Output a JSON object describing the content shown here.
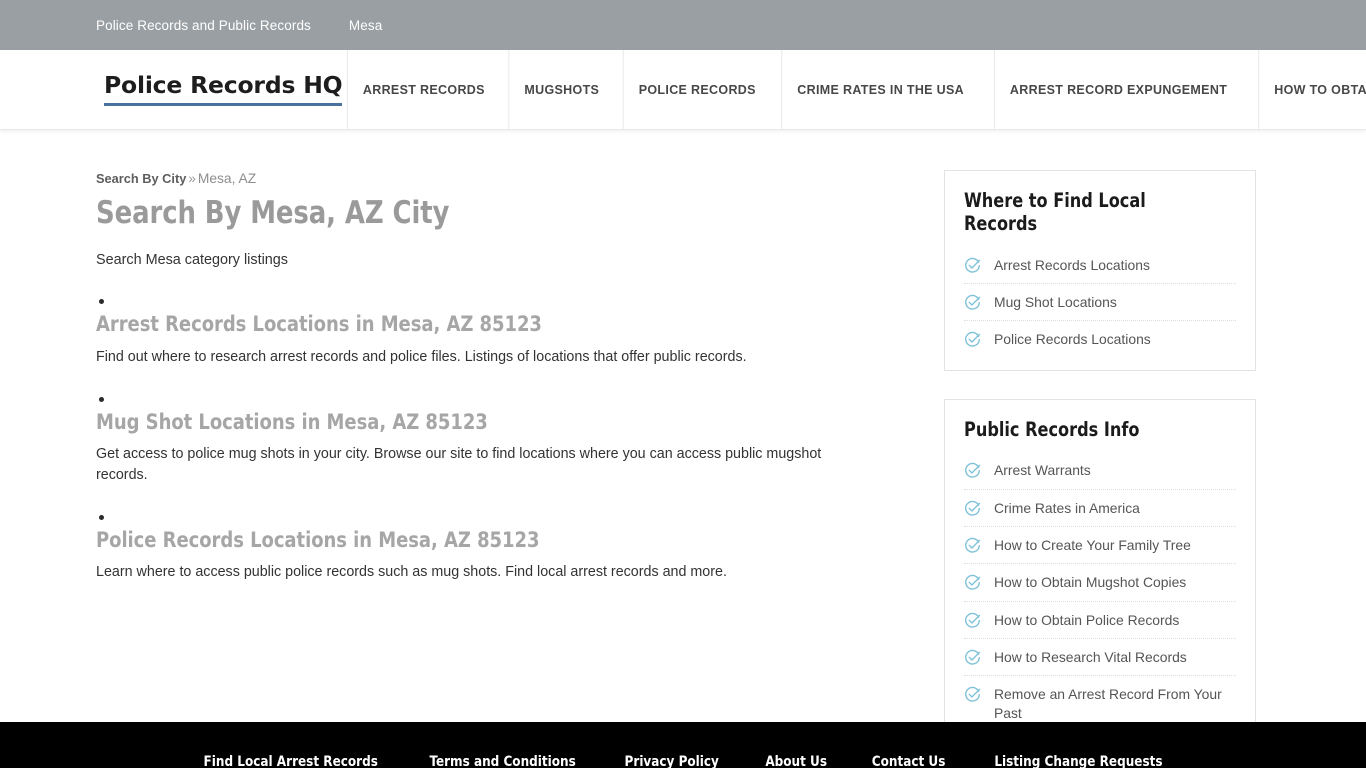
{
  "topbar": {
    "links": [
      {
        "label": "Police Records and Public Records"
      },
      {
        "label": "Mesa"
      }
    ]
  },
  "header": {
    "logo": "Police Records HQ",
    "logo_underline_color": "#46729c",
    "nav": [
      {
        "label": "ARREST RECORDS"
      },
      {
        "label": "MUGSHOTS"
      },
      {
        "label": "POLICE RECORDS"
      },
      {
        "label": "CRIME RATES IN THE USA"
      },
      {
        "label": "ARREST RECORD EXPUNGEMENT"
      },
      {
        "label": "HOW TO OBTAIN PUBLIC RECORDS"
      }
    ]
  },
  "breadcrumb": {
    "root": "Search By City",
    "separator": "»",
    "current": "Mesa, AZ"
  },
  "main": {
    "title": "Search By Mesa, AZ City",
    "intro": "Search Mesa category listings",
    "sections": [
      {
        "title": "Arrest Records Locations in Mesa, AZ 85123",
        "desc": "Find out where to research arrest records and police files. Listings of locations that offer public records."
      },
      {
        "title": "Mug Shot Locations in Mesa, AZ 85123",
        "desc": "Get access to police mug shots in your city. Browse our site to find locations where you can access public mugshot records."
      },
      {
        "title": "Police Records Locations in Mesa, AZ 85123",
        "desc": "Learn where to access public police records such as mug shots. Find local arrest records and more."
      }
    ]
  },
  "sidebar": {
    "icon_name": "check-circle-icon",
    "icon_color": "#7cc0d8",
    "widgets": [
      {
        "title": "Where to Find Local Records",
        "items": [
          {
            "label": "Arrest Records Locations"
          },
          {
            "label": "Mug Shot Locations"
          },
          {
            "label": "Police Records Locations"
          }
        ]
      },
      {
        "title": "Public Records Info",
        "items": [
          {
            "label": "Arrest Warrants"
          },
          {
            "label": "Crime Rates in America"
          },
          {
            "label": "How to Create Your Family Tree"
          },
          {
            "label": "How to Obtain Mugshot Copies"
          },
          {
            "label": "How to Obtain Police Records"
          },
          {
            "label": "How to Research Vital Records"
          },
          {
            "label": "Remove an Arrest Record From Your Past"
          }
        ]
      }
    ]
  },
  "footer": {
    "links": [
      {
        "label": "Find Local Arrest Records"
      },
      {
        "label": "Terms and Conditions"
      },
      {
        "label": "Privacy Policy"
      },
      {
        "label": "About Us"
      },
      {
        "label": "Contact Us"
      },
      {
        "label": "Listing Change Requests"
      }
    ]
  }
}
